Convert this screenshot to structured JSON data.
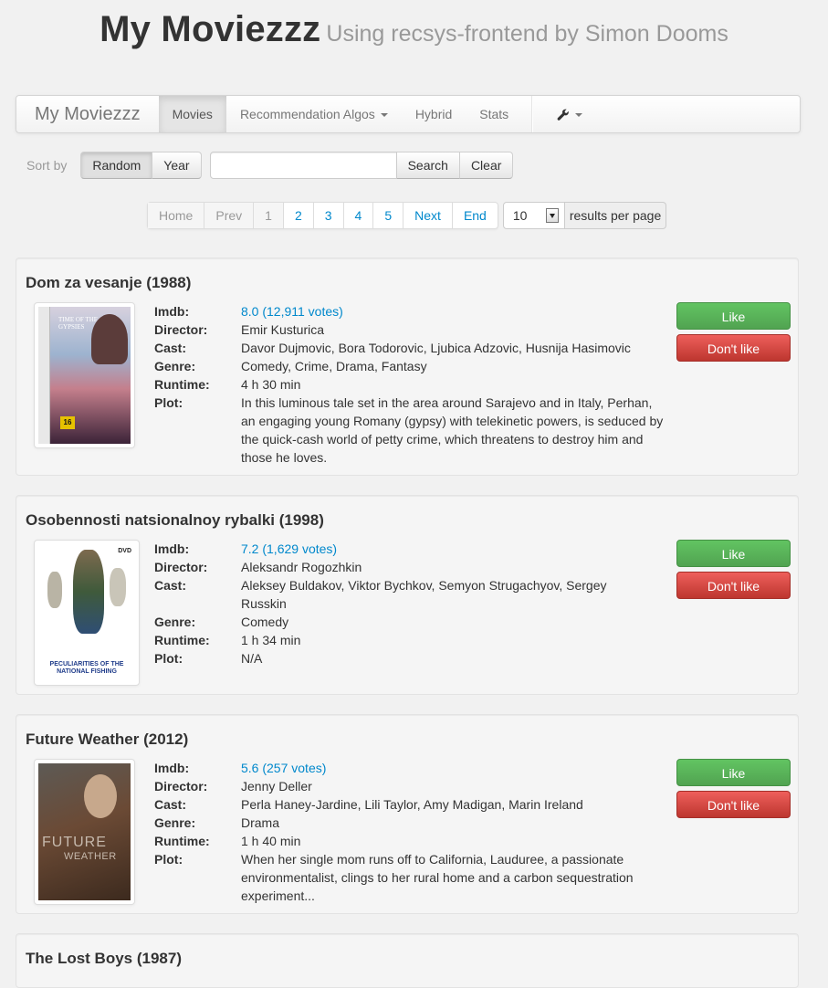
{
  "header": {
    "title": "My Moviezzz",
    "subtitle": "Using recsys-frontend by Simon Dooms"
  },
  "navbar": {
    "brand": "My Moviezzz",
    "items": [
      {
        "label": "Movies"
      },
      {
        "label": "Recommendation Algos"
      },
      {
        "label": "Hybrid"
      },
      {
        "label": "Stats"
      }
    ],
    "tools_icon": "wrench-icon"
  },
  "sort": {
    "label": "Sort by",
    "options": [
      "Random",
      "Year"
    ],
    "selected": "Random"
  },
  "search": {
    "value": "",
    "placeholder": "",
    "search_label": "Search",
    "clear_label": "Clear"
  },
  "pagination": {
    "home": "Home",
    "prev": "Prev",
    "pages": [
      "1",
      "2",
      "3",
      "4",
      "5"
    ],
    "current": "1",
    "next": "Next",
    "end": "End",
    "per_page_value": "10",
    "per_page_label": "results per page"
  },
  "labels": {
    "imdb": "Imdb:",
    "director": "Director:",
    "cast": "Cast:",
    "genre": "Genre:",
    "runtime": "Runtime:",
    "plot": "Plot:",
    "like": "Like",
    "dislike": "Don't like"
  },
  "movies": [
    {
      "title": "Dom za vesanje (1988)",
      "imdb": "8.0 (12,911 votes)",
      "director": "Emir Kusturica",
      "cast": "Davor Dujmovic, Bora Todorovic, Ljubica Adzovic, Husnija Hasimovic",
      "genre": "Comedy, Crime, Drama, Fantasy",
      "runtime": "4 h 30 min",
      "plot": "In this luminous tale set in the area around Sarajevo and in Italy, Perhan, an engaging young Romany (gypsy) with telekinetic powers, is seduced by the quick-cash world of petty crime, which threatens to destroy him and those he loves.",
      "poster_text_1": "TIME OF THE GYPSIES",
      "poster_text_2": "16"
    },
    {
      "title": "Osobennosti natsionalnoy rybalki (1998)",
      "imdb": "7.2 (1,629 votes)",
      "director": "Aleksandr Rogozhkin",
      "cast": "Aleksey Buldakov, Viktor Bychkov, Semyon Strugachyov, Sergey Russkin",
      "genre": "Comedy",
      "runtime": "1 h 34 min",
      "plot": "N/A",
      "poster_text_1": "PECULIARITIES OF THE NATIONAL FISHING",
      "poster_text_2": "DVD"
    },
    {
      "title": "Future Weather (2012)",
      "imdb": "5.6 (257 votes)",
      "director": "Jenny Deller",
      "cast": "Perla Haney-Jardine, Lili Taylor, Amy Madigan, Marin Ireland",
      "genre": "Drama",
      "runtime": "1 h 40 min",
      "plot": "When her single mom runs off to California, Lauduree, a passionate environmentalist, clings to her rural home and a carbon sequestration experiment...",
      "poster_text_1": "FUTURE",
      "poster_text_2": "WEATHER"
    },
    {
      "title": "The Lost Boys (1987)"
    }
  ]
}
